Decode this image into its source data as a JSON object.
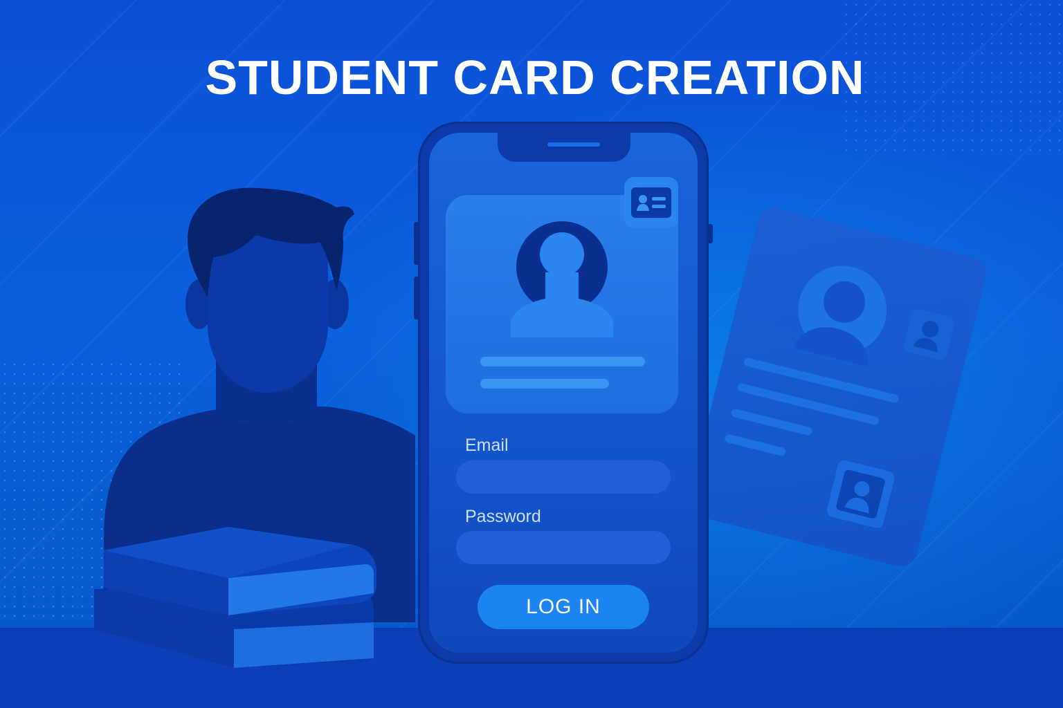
{
  "title": "STUDENT CARD CREATION",
  "login_form": {
    "email_label": "Email",
    "password_label": "Password",
    "login_button": "LOG IN"
  },
  "colors": {
    "background": "#0b56d4",
    "phone_body": "#0c3aa8",
    "button": "#1b84f0",
    "silhouette": "#0a2e8a",
    "title_text": "#ffffff"
  },
  "icons": [
    "student-silhouette-icon",
    "books-icon",
    "id-card-icon",
    "avatar-icon",
    "photo-icon"
  ]
}
